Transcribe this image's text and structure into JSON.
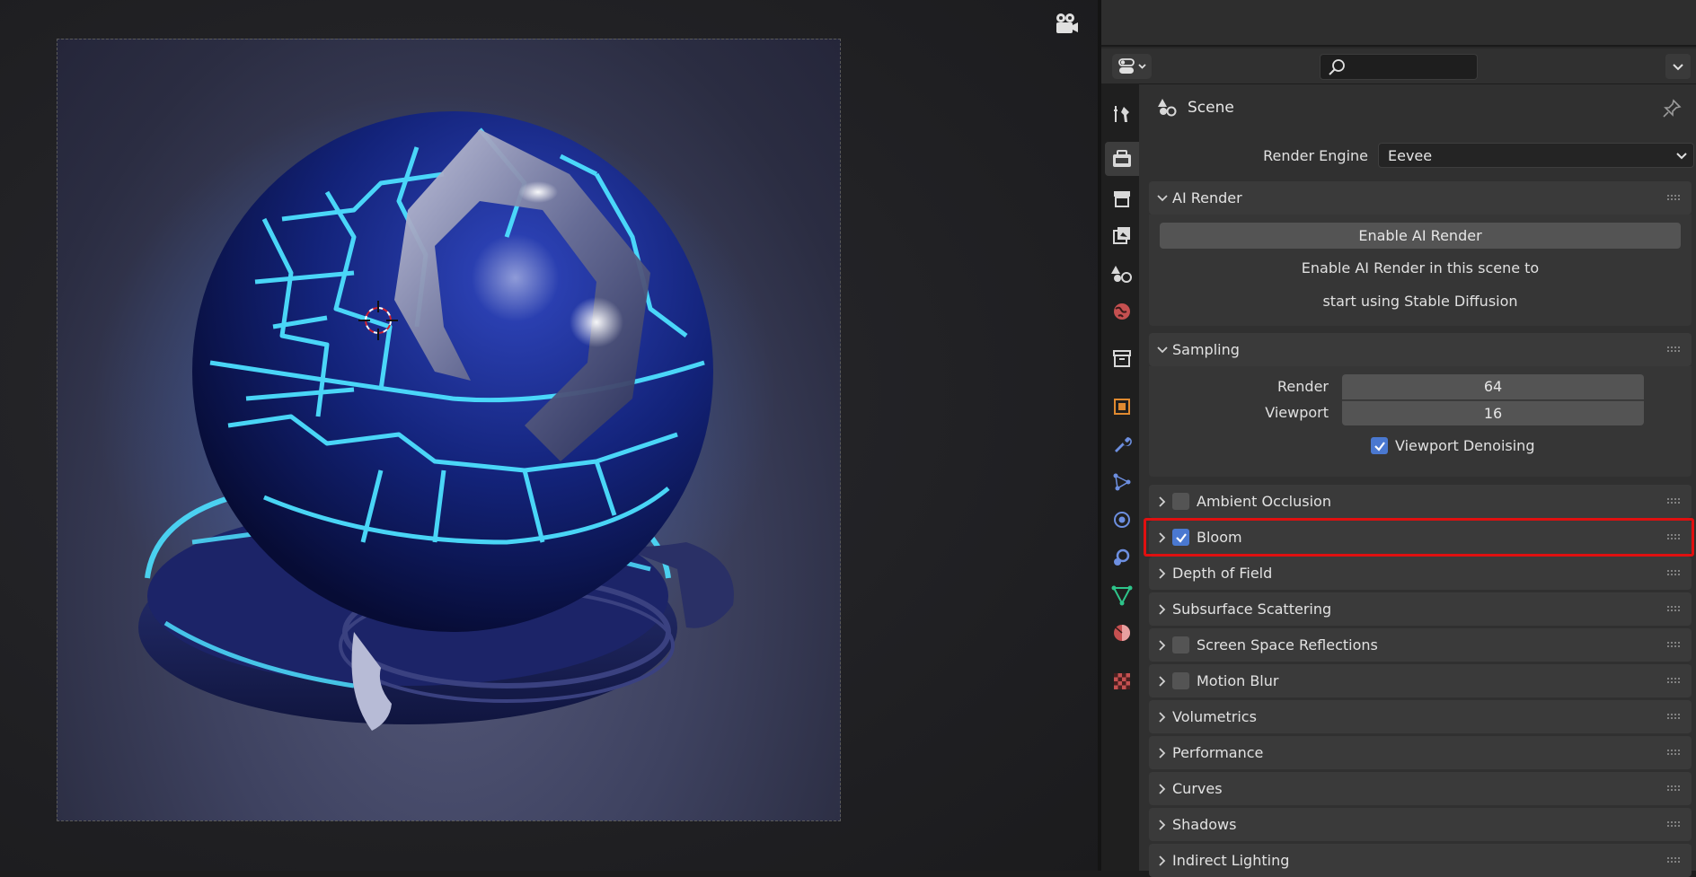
{
  "viewport": {
    "icons": {
      "camera": "camera-icon"
    }
  },
  "header": {
    "editor_type_icon": "properties-editor-icon",
    "search": {
      "placeholder": "",
      "icon": "search-icon"
    }
  },
  "sidebar_tabs": [
    {
      "name": "tool",
      "icon": "tool-icon"
    },
    {
      "name": "render",
      "icon": "render-icon",
      "active": true
    },
    {
      "name": "output",
      "icon": "output-icon"
    },
    {
      "name": "view-layer",
      "icon": "view-layer-icon"
    },
    {
      "name": "scene",
      "icon": "scene-icon"
    },
    {
      "name": "world",
      "icon": "world-icon"
    },
    {
      "name": "collection",
      "icon": "collection-icon"
    },
    {
      "name": "object",
      "icon": "object-icon"
    },
    {
      "name": "modifiers",
      "icon": "wrench-icon"
    },
    {
      "name": "particles",
      "icon": "particles-icon"
    },
    {
      "name": "physics",
      "icon": "physics-icon"
    },
    {
      "name": "constraints",
      "icon": "constraints-icon"
    },
    {
      "name": "data",
      "icon": "mesh-data-icon"
    },
    {
      "name": "material",
      "icon": "material-icon"
    },
    {
      "name": "texture",
      "icon": "texture-icon"
    }
  ],
  "content": {
    "title": "Scene",
    "render_engine": {
      "label": "Render Engine",
      "value": "Eevee"
    },
    "ai_render": {
      "title": "AI Render",
      "button": "Enable AI Render",
      "line1": "Enable AI Render in this scene to",
      "line2": "start using Stable Diffusion"
    },
    "sampling": {
      "title": "Sampling",
      "render_label": "Render",
      "render_value": "64",
      "viewport_label": "Viewport",
      "viewport_value": "16",
      "denoise_label": "Viewport Denoising",
      "denoise_checked": true
    },
    "panels": [
      {
        "label": "Ambient Occlusion",
        "checkbox": false
      },
      {
        "label": "Bloom",
        "checkbox": true,
        "highlighted": true
      },
      {
        "label": "Depth of Field"
      },
      {
        "label": "Subsurface Scattering"
      },
      {
        "label": "Screen Space Reflections",
        "checkbox": false
      },
      {
        "label": "Motion Blur",
        "checkbox": false
      },
      {
        "label": "Volumetrics"
      },
      {
        "label": "Performance"
      },
      {
        "label": "Curves"
      },
      {
        "label": "Shadows"
      },
      {
        "label": "Indirect Lighting"
      }
    ]
  },
  "colors": {
    "accent": "#4a78d0",
    "highlight": "#e01010",
    "glow": "#3fd3ff",
    "sphere": "#1b2f8f"
  }
}
